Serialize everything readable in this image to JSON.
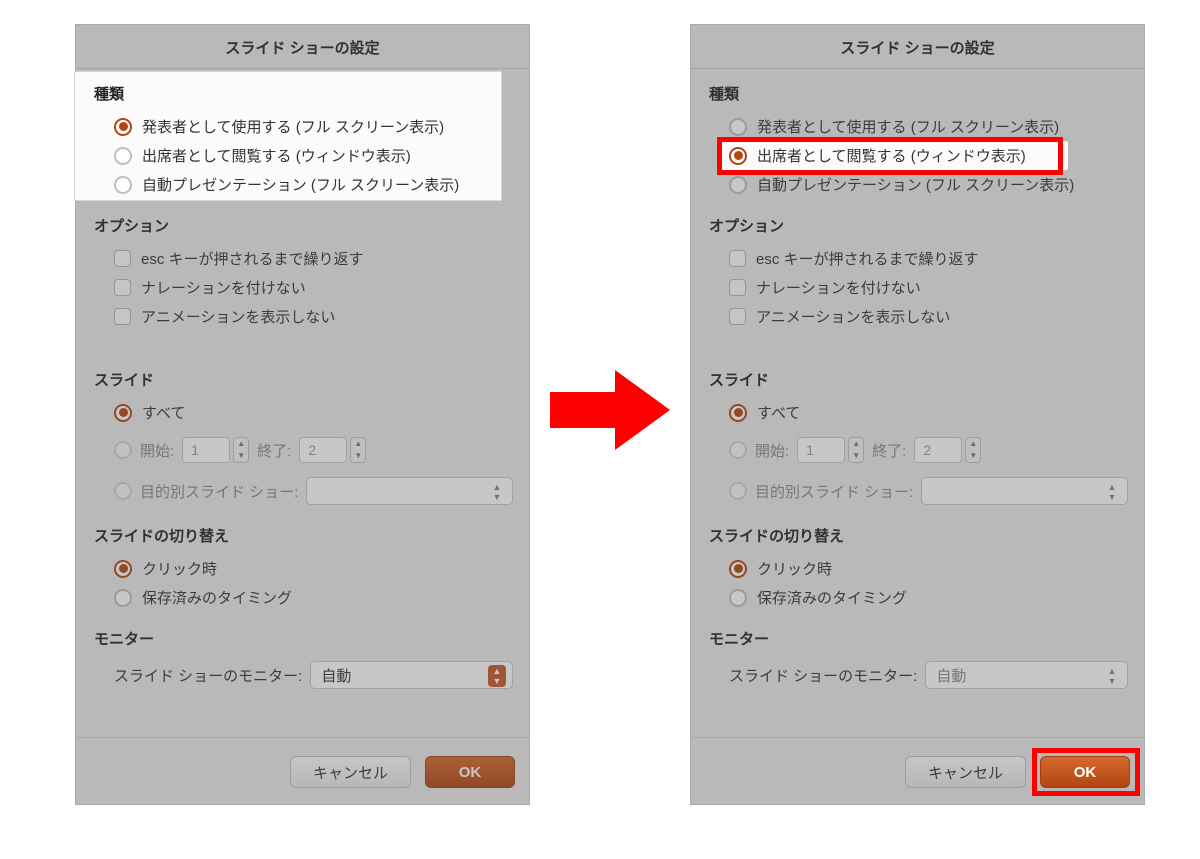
{
  "dialog_title": "スライド ショーの設定",
  "sections": {
    "type": "種類",
    "options": "オプション",
    "slides": "スライド",
    "advance": "スライドの切り替え",
    "monitor": "モニター"
  },
  "type_options": {
    "presenter": "発表者として使用する (フル スクリーン表示)",
    "browsed": "出席者として閲覧する (ウィンドウ表示)",
    "kiosk": "自動プレゼンテーション (フル スクリーン表示)"
  },
  "option_checks": {
    "loop": "esc キーが押されるまで繰り返す",
    "noNarr": "ナレーションを付けない",
    "noAnim": "アニメーションを表示しない"
  },
  "slide_radios": {
    "all": "すべて",
    "from": "開始:",
    "to": "終了:",
    "custom": "目的別スライド ショー:"
  },
  "slide_values": {
    "from": "1",
    "to": "2"
  },
  "advance_radios": {
    "manual": "クリック時",
    "timing": "保存済みのタイミング"
  },
  "monitor": {
    "label": "スライド ショーのモニター:",
    "value": "自動"
  },
  "buttons": {
    "cancel": "キャンセル",
    "ok": "OK"
  }
}
